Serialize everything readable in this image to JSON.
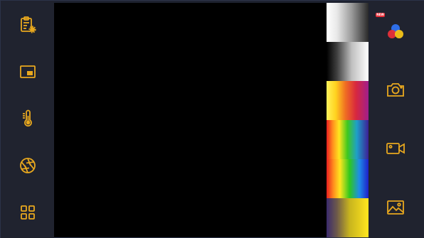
{
  "colors": {
    "background": "#1e2230",
    "sidebar": "#20232f",
    "icon_accent": "#e8a81e",
    "viewport": "#000000",
    "badge": "#e8303a"
  },
  "left_toolbar": {
    "items": [
      {
        "icon": "clipboard-settings-icon"
      },
      {
        "icon": "picture-in-picture-icon"
      },
      {
        "icon": "thermometer-icon"
      },
      {
        "icon": "aperture-icon"
      },
      {
        "icon": "grid-icon"
      }
    ]
  },
  "palettes": [
    {
      "name": "white-hot"
    },
    {
      "name": "black-hot"
    },
    {
      "name": "iron"
    },
    {
      "name": "rainbow"
    },
    {
      "name": "rainbow-hc"
    },
    {
      "name": "lava"
    }
  ],
  "right_toolbar": {
    "badge_text": "NEW",
    "items": [
      {
        "icon": "color-palette-icon"
      },
      {
        "icon": "camera-icon"
      },
      {
        "icon": "video-camera-icon"
      },
      {
        "icon": "gallery-icon"
      }
    ]
  }
}
